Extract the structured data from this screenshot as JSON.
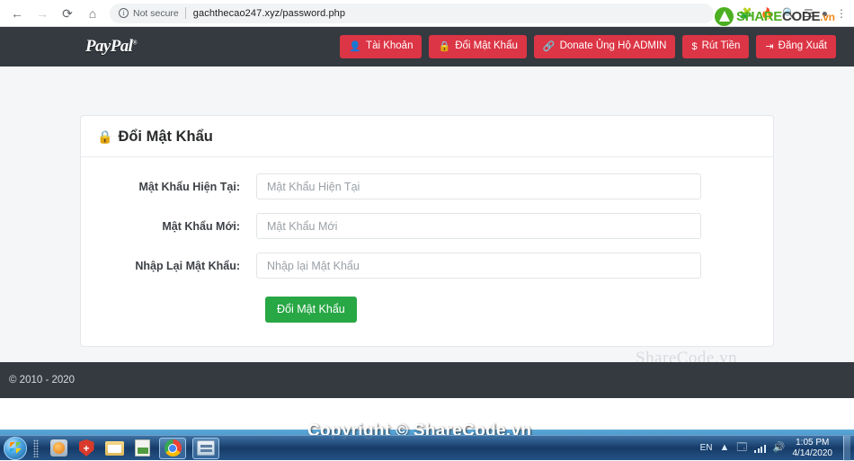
{
  "browser": {
    "back_icon": "←",
    "forward_icon": "→",
    "reload_icon": "⟳",
    "home_icon": "⌂",
    "security_label": "Not secure",
    "url": "gachthecao247.xyz/password.php",
    "url_domain": "gachthecao247.xyz",
    "url_path": "/password.php",
    "star_icon": "☆",
    "menu_icon": "⋮",
    "search_icon": "🔍",
    "list_icon": "☰"
  },
  "watermark_logo": {
    "share": "SHARE",
    "code": "CODE",
    "vn": ".vn"
  },
  "navbar": {
    "brand": "PayPal",
    "brand_reg": "®",
    "buttons": [
      {
        "label": "Tài Khoản",
        "icon": "👤",
        "name": "account"
      },
      {
        "label": "Đổi Mật Khẩu",
        "icon": "🔒",
        "name": "change-password"
      },
      {
        "label": "Donate Ủng Hộ ADMIN",
        "icon": "🔗",
        "name": "donate"
      },
      {
        "label": "Rút Tiền",
        "icon": "$",
        "name": "withdraw"
      },
      {
        "label": "Đăng Xuất",
        "icon": "⇥",
        "name": "logout"
      }
    ]
  },
  "card": {
    "title": "Đổi Mật Khẩu",
    "lock_icon": "🔒",
    "fields": [
      {
        "label": "Mật Khẩu Hiện Tại:",
        "placeholder": "Mật Khẩu Hiện Tại",
        "value": "",
        "name": "current-password"
      },
      {
        "label": "Mật Khẩu Mới:",
        "placeholder": "Mật Khẩu Mới",
        "value": "",
        "name": "new-password"
      },
      {
        "label": "Nhập Lại Mật Khẩu:",
        "placeholder": "Nhập lại Mật Khẩu",
        "value": "",
        "name": "confirm-password"
      }
    ],
    "submit_label": "Đổi Mật Khẩu"
  },
  "page_watermark": "ShareCode.vn",
  "footer": {
    "copyright": "© 2010 - 2020"
  },
  "desktop": {
    "watermark": "Copyright © ShareCode.vn"
  },
  "taskbar": {
    "items": [
      {
        "name": "media-player",
        "label": "Windows Media Player"
      },
      {
        "name": "antivirus-shield",
        "label": "Antivirus"
      },
      {
        "name": "file-explorer",
        "label": "File Explorer"
      },
      {
        "name": "notepad",
        "label": "Notepad"
      },
      {
        "name": "google-chrome",
        "label": "Google Chrome"
      },
      {
        "name": "control-panel",
        "label": "Control Panel"
      }
    ],
    "tray": {
      "language": "EN",
      "time": "1:05 PM",
      "date": "4/14/2020"
    }
  },
  "colors": {
    "navbar_bg": "#343a40",
    "danger": "#dc3545",
    "success": "#28a745",
    "page_bg": "#f5f6f8"
  }
}
